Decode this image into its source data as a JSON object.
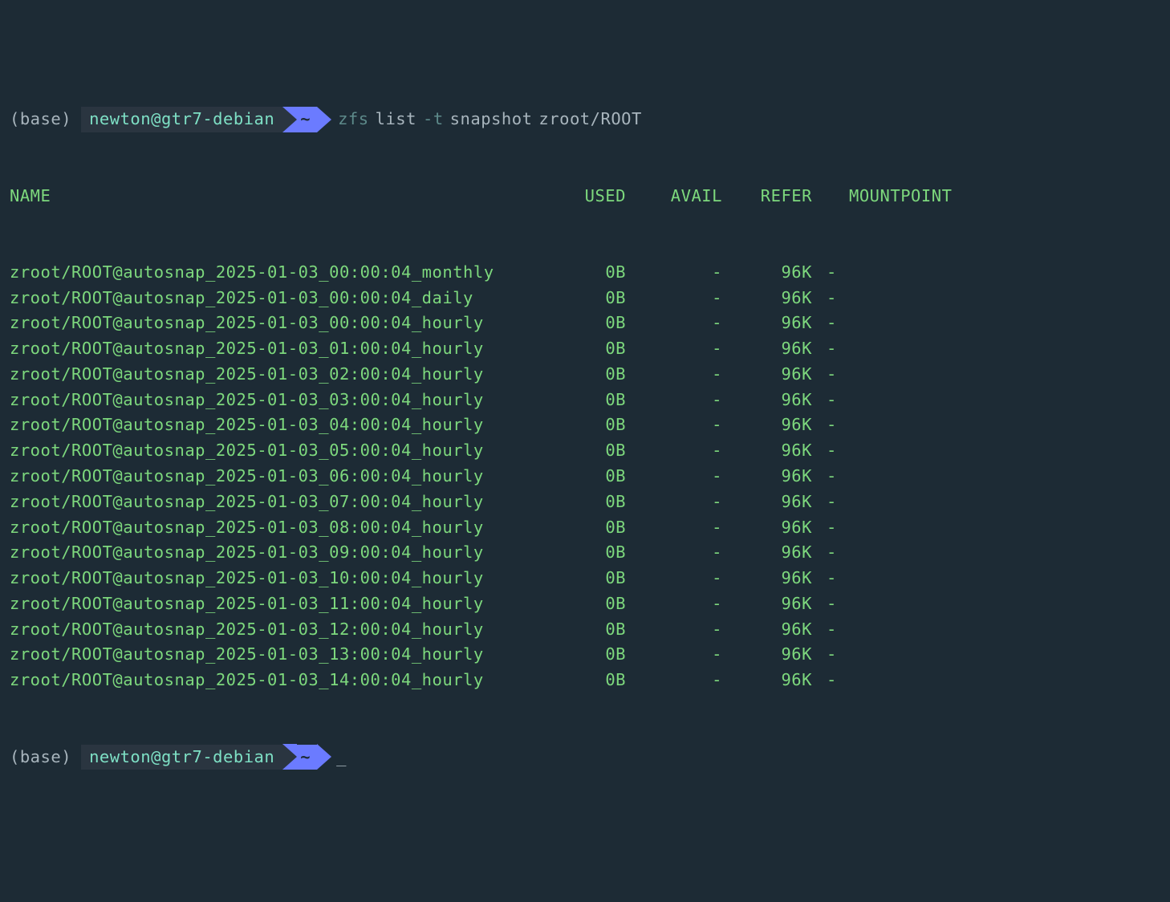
{
  "prompt1": {
    "env": "(base)",
    "user_host": "newton@gtr7-debian",
    "cwd": "~",
    "cmd_parts": {
      "zfs": "zfs",
      "list": "list",
      "flag": "-t",
      "snapshot": "snapshot",
      "target": "zroot/ROOT"
    }
  },
  "headers": {
    "name": "NAME",
    "used": "USED",
    "avail": "AVAIL",
    "refer": "REFER",
    "mountpoint": "MOUNTPOINT"
  },
  "rows": [
    {
      "name": "zroot/ROOT@autosnap_2025-01-03_00:00:04_monthly",
      "used": "0B",
      "avail": "-",
      "refer": "96K",
      "mountpoint": "-"
    },
    {
      "name": "zroot/ROOT@autosnap_2025-01-03_00:00:04_daily",
      "used": "0B",
      "avail": "-",
      "refer": "96K",
      "mountpoint": "-"
    },
    {
      "name": "zroot/ROOT@autosnap_2025-01-03_00:00:04_hourly",
      "used": "0B",
      "avail": "-",
      "refer": "96K",
      "mountpoint": "-"
    },
    {
      "name": "zroot/ROOT@autosnap_2025-01-03_01:00:04_hourly",
      "used": "0B",
      "avail": "-",
      "refer": "96K",
      "mountpoint": "-"
    },
    {
      "name": "zroot/ROOT@autosnap_2025-01-03_02:00:04_hourly",
      "used": "0B",
      "avail": "-",
      "refer": "96K",
      "mountpoint": "-"
    },
    {
      "name": "zroot/ROOT@autosnap_2025-01-03_03:00:04_hourly",
      "used": "0B",
      "avail": "-",
      "refer": "96K",
      "mountpoint": "-"
    },
    {
      "name": "zroot/ROOT@autosnap_2025-01-03_04:00:04_hourly",
      "used": "0B",
      "avail": "-",
      "refer": "96K",
      "mountpoint": "-"
    },
    {
      "name": "zroot/ROOT@autosnap_2025-01-03_05:00:04_hourly",
      "used": "0B",
      "avail": "-",
      "refer": "96K",
      "mountpoint": "-"
    },
    {
      "name": "zroot/ROOT@autosnap_2025-01-03_06:00:04_hourly",
      "used": "0B",
      "avail": "-",
      "refer": "96K",
      "mountpoint": "-"
    },
    {
      "name": "zroot/ROOT@autosnap_2025-01-03_07:00:04_hourly",
      "used": "0B",
      "avail": "-",
      "refer": "96K",
      "mountpoint": "-"
    },
    {
      "name": "zroot/ROOT@autosnap_2025-01-03_08:00:04_hourly",
      "used": "0B",
      "avail": "-",
      "refer": "96K",
      "mountpoint": "-"
    },
    {
      "name": "zroot/ROOT@autosnap_2025-01-03_09:00:04_hourly",
      "used": "0B",
      "avail": "-",
      "refer": "96K",
      "mountpoint": "-"
    },
    {
      "name": "zroot/ROOT@autosnap_2025-01-03_10:00:04_hourly",
      "used": "0B",
      "avail": "-",
      "refer": "96K",
      "mountpoint": "-"
    },
    {
      "name": "zroot/ROOT@autosnap_2025-01-03_11:00:04_hourly",
      "used": "0B",
      "avail": "-",
      "refer": "96K",
      "mountpoint": "-"
    },
    {
      "name": "zroot/ROOT@autosnap_2025-01-03_12:00:04_hourly",
      "used": "0B",
      "avail": "-",
      "refer": "96K",
      "mountpoint": "-"
    },
    {
      "name": "zroot/ROOT@autosnap_2025-01-03_13:00:04_hourly",
      "used": "0B",
      "avail": "-",
      "refer": "96K",
      "mountpoint": "-"
    },
    {
      "name": "zroot/ROOT@autosnap_2025-01-03_14:00:04_hourly",
      "used": "0B",
      "avail": "-",
      "refer": "96K",
      "mountpoint": "-"
    }
  ],
  "prompt2": {
    "env": "(base)",
    "user_host": "newton@gtr7-debian",
    "cwd": "~",
    "cursor": "_"
  }
}
